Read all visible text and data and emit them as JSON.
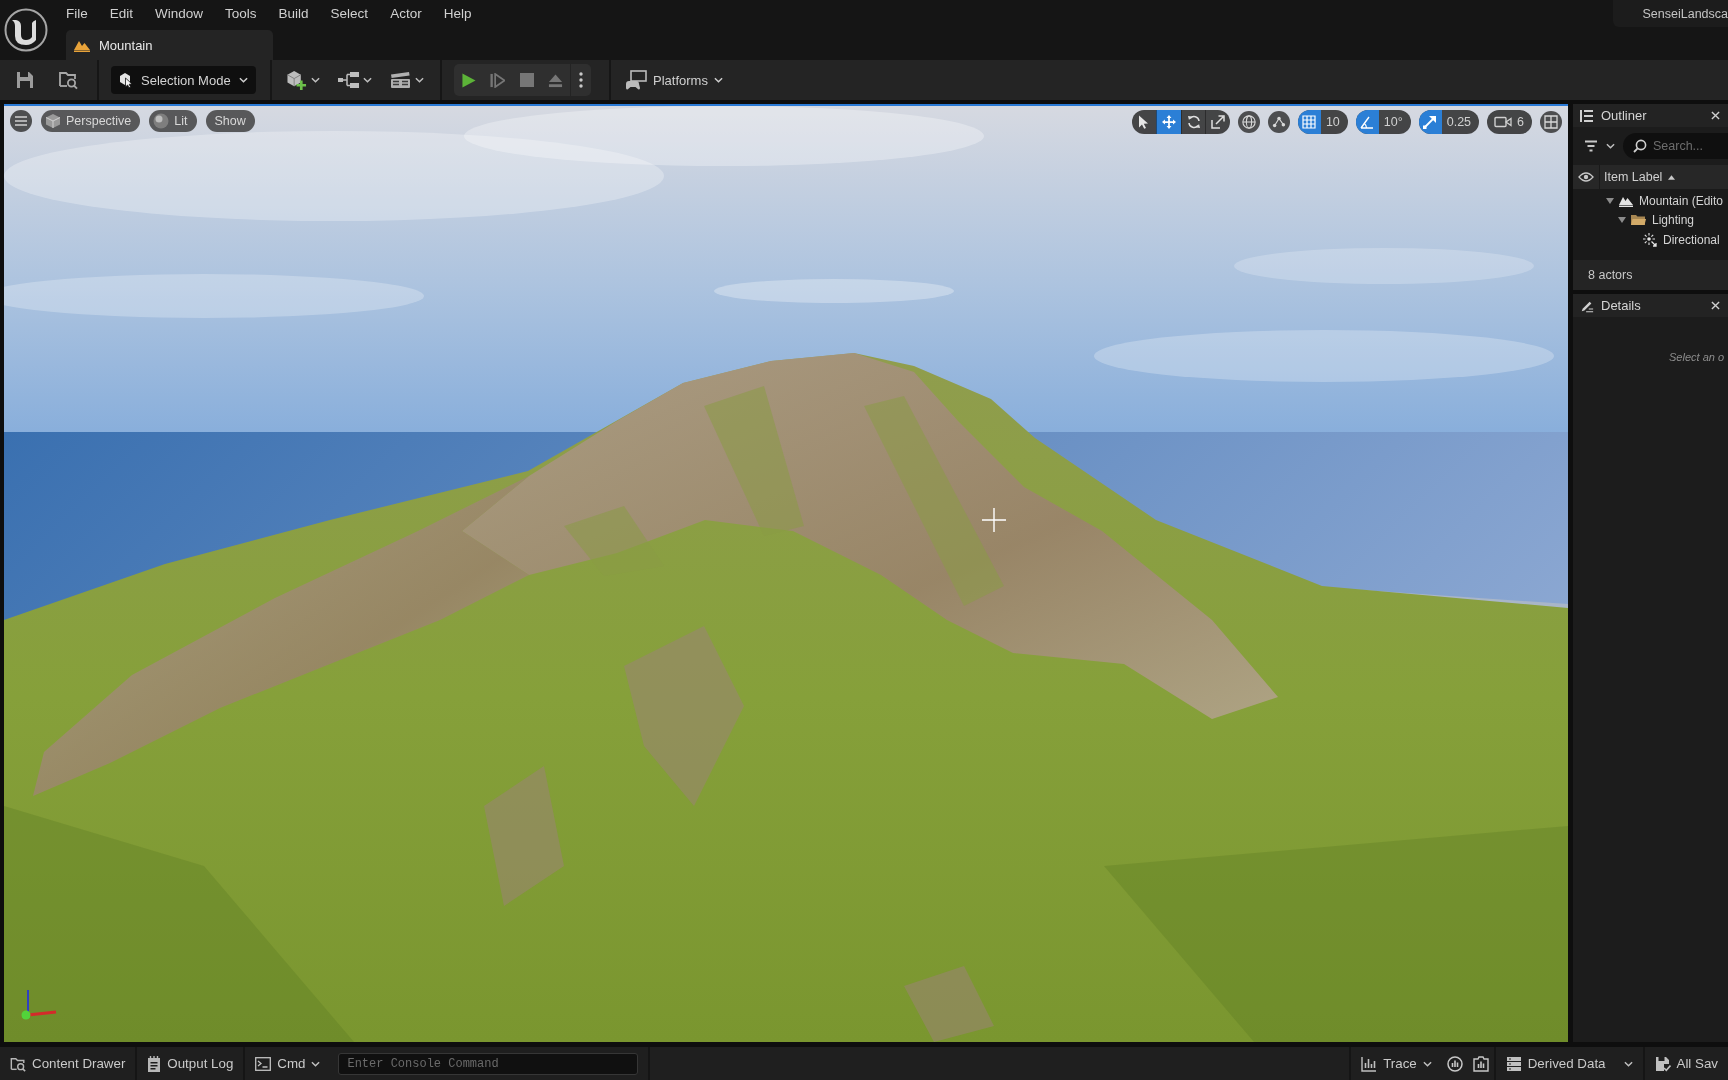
{
  "menu_bar": {
    "items": [
      "File",
      "Edit",
      "Window",
      "Tools",
      "Build",
      "Select",
      "Actor",
      "Help"
    ],
    "project": "SenseiLandsca"
  },
  "document_tabs": [
    {
      "label": "Mountain",
      "selected": true
    }
  ],
  "toolbar": {
    "mode": "Selection Mode",
    "play_controls": [
      {
        "kind": "play",
        "disabled": false
      },
      {
        "kind": "advance",
        "disabled": true
      },
      {
        "kind": "stop",
        "disabled": true
      },
      {
        "kind": "eject",
        "disabled": true
      }
    ],
    "platforms": "Platforms"
  },
  "viewport": {
    "view_buttons": [
      {
        "kind": "menu"
      },
      {
        "kind": "perspective",
        "label": "Perspective"
      },
      {
        "kind": "lit",
        "label": "Lit"
      },
      {
        "kind": "show",
        "label": "Show"
      }
    ],
    "transform_tools": [
      {
        "kind": "select",
        "selected": false
      },
      {
        "kind": "move",
        "selected": true
      },
      {
        "kind": "rotate",
        "selected": false
      },
      {
        "kind": "scale",
        "selected": false
      }
    ],
    "snaps": [
      {
        "kind": "grid",
        "on": true,
        "value": "10"
      },
      {
        "kind": "angle",
        "on": true,
        "value": "10°"
      },
      {
        "kind": "scale",
        "on": true,
        "value": "0.25"
      }
    ],
    "camera_speed": "6"
  },
  "outliner": {
    "title": "Outliner",
    "search": {
      "placeholder": "Search..."
    },
    "column": "Item Label",
    "tree": [
      {
        "label": "Mountain (Edito",
        "kind": "level",
        "expanded": true,
        "children": [
          {
            "label": "Lighting",
            "kind": "folder",
            "expanded": true,
            "children": [
              {
                "label": "Directional",
                "kind": "light"
              }
            ]
          }
        ]
      }
    ],
    "count": "8 actors"
  },
  "details": {
    "title": "Details",
    "hint": "Select an o"
  },
  "status_bar": {
    "left": [
      {
        "kind": "content",
        "label": "Content Drawer"
      },
      {
        "kind": "log",
        "label": "Output Log"
      }
    ],
    "cmd": "Cmd",
    "console": {
      "placeholder": "Enter Console Command"
    },
    "right": [
      {
        "kind": "trace",
        "label": "Trace"
      },
      {
        "kind": "derived",
        "label": "Derived Data"
      },
      {
        "kind": "save",
        "label": "All Sav"
      }
    ]
  }
}
